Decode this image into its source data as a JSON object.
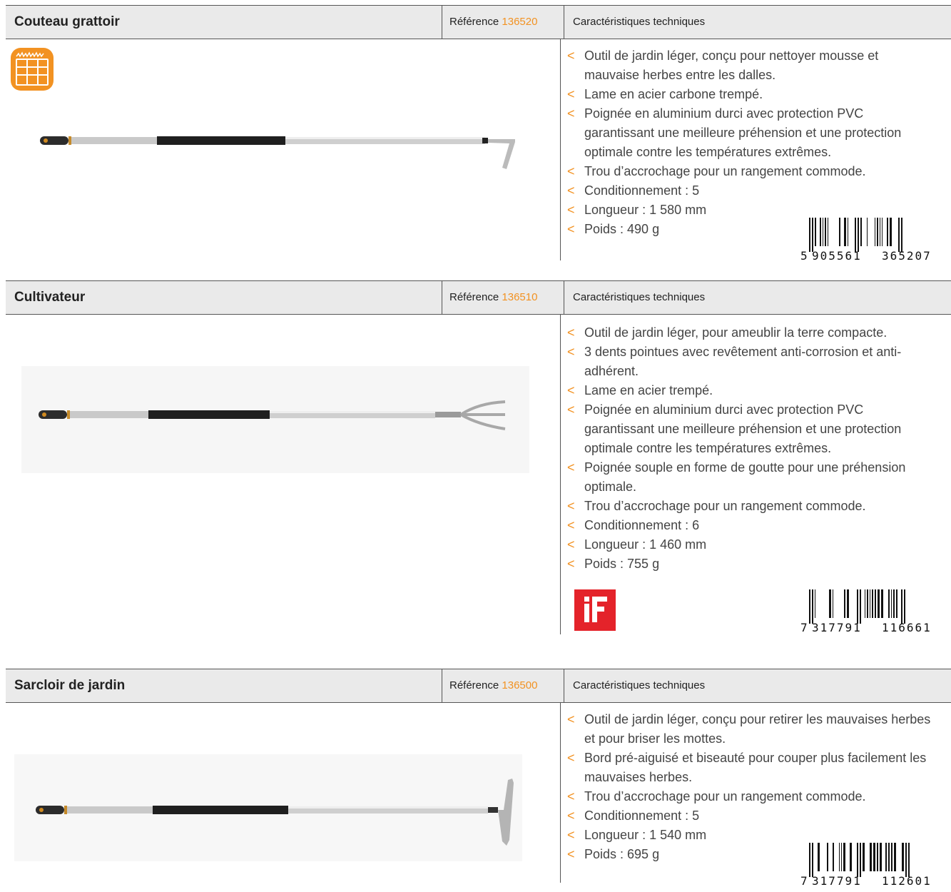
{
  "products": [
    {
      "title": "Couteau grattoir",
      "reference_label": "Référence",
      "reference_number": "136520",
      "specs_title": "Caractéristiques techniques",
      "bullet": "<",
      "features": [
        "Outil de jardin léger, conçu pour nettoyer mousse et mauvaise herbes entre les dalles.",
        "Lame en acier carbone trempé.",
        "Poignée en aluminium durci avec protection PVC garantissant une meilleure préhension et une protection optimale contre les températures extrêmes.",
        "Trou d’accrochage pour un rangement commode.",
        "Conditionnement : 5",
        "Longueur : 1 580 mm",
        "Poids : 490 g"
      ],
      "barcode": {
        "first": "5",
        "left": "905561",
        "right": "365207"
      },
      "badge_icon": "paving-grid-icon",
      "tool_head": "scraper-hook"
    },
    {
      "title": "Cultivateur",
      "reference_label": "Référence",
      "reference_number": "136510",
      "specs_title": "Caractéristiques techniques",
      "bullet": "<",
      "features": [
        "Outil de jardin léger, pour ameublir la terre compacte.",
        "3 dents pointues avec revêtement anti-corrosion et anti-adhérent.",
        "Lame en acier trempé.",
        "Poignée en aluminium durci avec protection PVC garantissant une meilleure préhension et une protection optimale contre les températures extrêmes.",
        "Poignée souple en forme de goutte pour une préhension optimale.",
        "Trou d’accrochage pour un rangement commode.",
        "Conditionnement : 6",
        "Longueur : 1 460 mm",
        "Poids : 755 g"
      ],
      "barcode": {
        "first": "7",
        "left": "317791",
        "right": "116661"
      },
      "award_icon": "if-design-award-icon",
      "tool_head": "three-tine-cultivator"
    },
    {
      "title": "Sarcloir de jardin",
      "reference_label": "Référence",
      "reference_number": "136500",
      "specs_title": "Caractéristiques techniques",
      "bullet": "<",
      "features": [
        "Outil de jardin léger, conçu pour retirer les mauvaises herbes et pour briser les mottes.",
        "Bord pré-aiguisé et biseauté pour couper plus facilement les mauvaises herbes.",
        "Trou d’accrochage pour un rangement commode.",
        "Conditionnement : 5",
        "Longueur : 1 540 mm",
        "Poids : 695 g"
      ],
      "barcode": {
        "first": "7",
        "left": "317791",
        "right": "112601"
      },
      "tool_head": "hoe-blade"
    }
  ],
  "colors": {
    "accent": "#f29222",
    "header_bg": "#eaeaea",
    "award_red": "#e4232a"
  }
}
